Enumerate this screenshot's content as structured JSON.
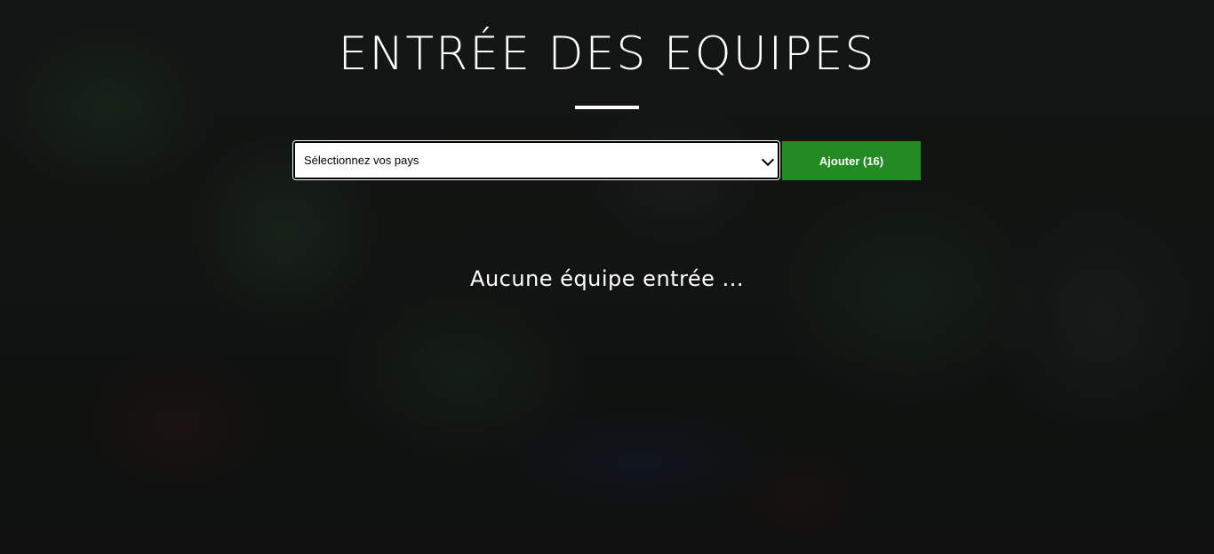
{
  "page": {
    "title": "ENTRÉE DES EQUIPES"
  },
  "form": {
    "select_value": "Sélectionnez vos pays",
    "add_label": "Ajouter (16)"
  },
  "teams": {
    "empty_message": "Aucune équipe entrée ..."
  },
  "colors": {
    "add_button": "#228b22",
    "text": "#ffffff"
  }
}
